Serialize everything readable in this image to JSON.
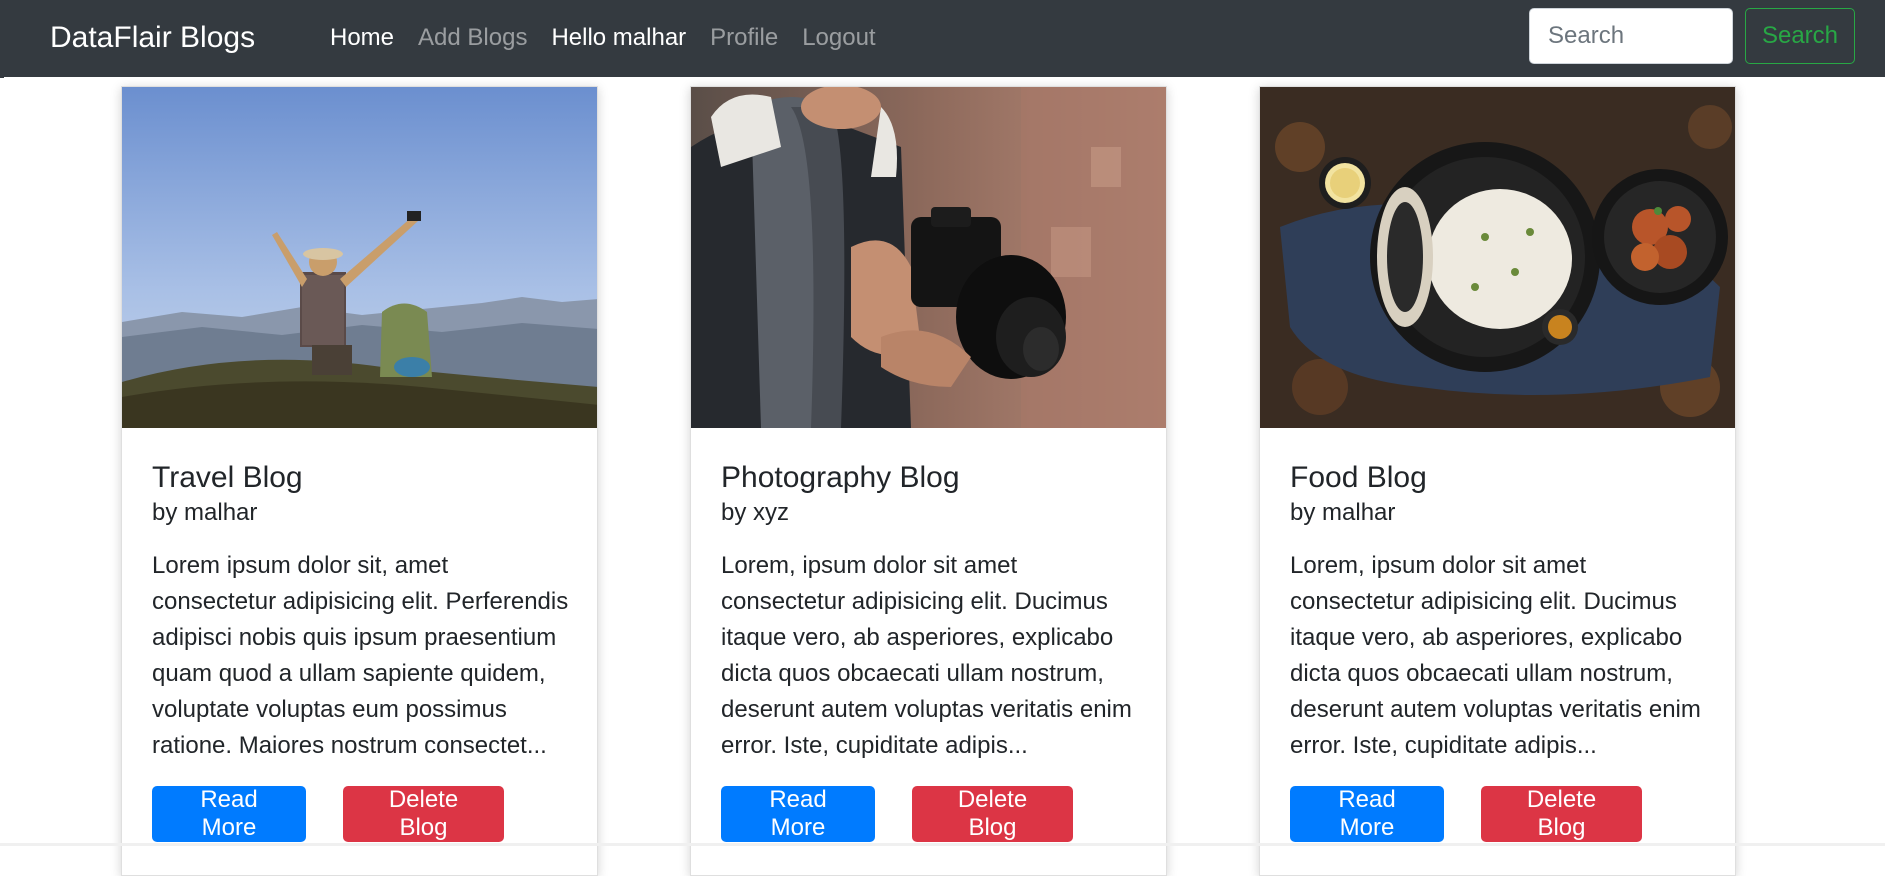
{
  "navbar": {
    "brand": "DataFlair Blogs",
    "links": [
      {
        "label": "Home"
      },
      {
        "label": "Add Blogs"
      },
      {
        "label": "Hello malhar"
      },
      {
        "label": "Profile"
      },
      {
        "label": "Logout"
      }
    ],
    "search": {
      "placeholder": "Search",
      "button_label": "Search"
    }
  },
  "cards": [
    {
      "title": "Travel Blog",
      "author": "by malhar",
      "excerpt": "Lorem ipsum dolor sit, amet consectetur adipisicing elit. Perferendis adipisci nobis quis ipsum praesentium quam quod a ullam sapiente quidem, voluptate voluptas eum possimus ratione. Maiores nostrum consectet...",
      "read_more": "Read More",
      "delete": "Delete Blog"
    },
    {
      "title": "Photography Blog",
      "author": "by xyz",
      "excerpt": "Lorem, ipsum dolor sit amet consectetur adipisicing elit. Ducimus itaque vero, ab asperiores, explicabo dicta quos obcaecati ullam nostrum, deserunt autem voluptas veritatis enim error. Iste, cupiditate adipis...",
      "read_more": "Read More",
      "delete": "Delete Blog"
    },
    {
      "title": "Food Blog",
      "author": "by malhar",
      "excerpt": "Lorem, ipsum dolor sit amet consectetur adipisicing elit. Ducimus itaque vero, ab asperiores, explicabo dicta quos obcaecati ullam nostrum, deserunt autem voluptas veritatis enim error. Iste, cupiditate adipis...",
      "read_more": "Read More",
      "delete": "Delete Blog"
    }
  ],
  "colors": {
    "navbar_bg": "#343a40",
    "primary": "#007bff",
    "danger": "#dc3545",
    "success": "#28a745"
  }
}
